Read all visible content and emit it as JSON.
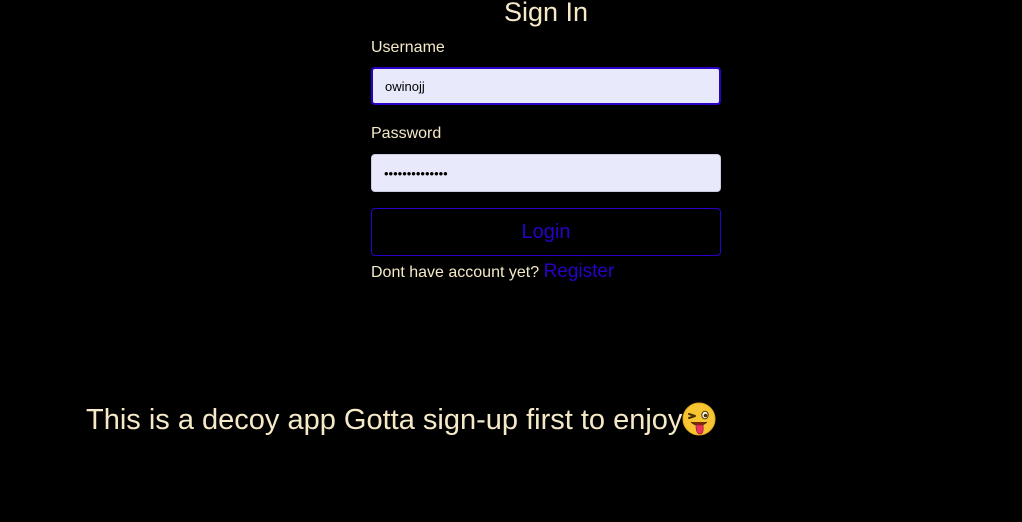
{
  "form": {
    "title": "Sign In",
    "username_label": "Username",
    "username_value": "owinojj",
    "password_label": "Password",
    "password_value": "••••••••••••••",
    "login_label": "Login",
    "no_account_text": "Dont have account yet?",
    "register_label": "Register"
  },
  "footer": {
    "message": "This is a decoy app Gotta sign-up first to enjoy",
    "emoji_icon": "winking-face-with-tongue-icon"
  },
  "colors": {
    "background": "#000000",
    "text": "#f5e9c8",
    "accent": "#2a00c8",
    "input_bg": "#e8eafc"
  }
}
